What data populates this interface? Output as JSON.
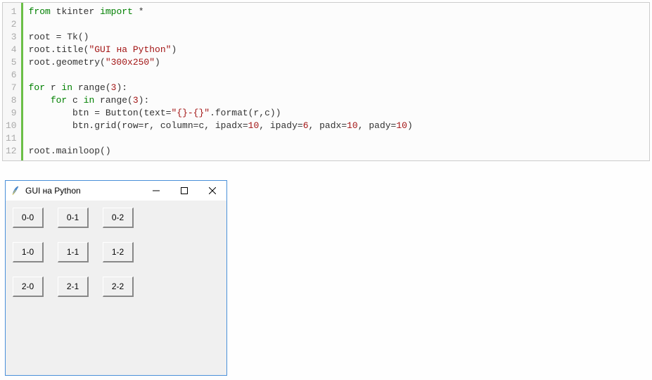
{
  "code": {
    "lines": [
      "1",
      "2",
      "3",
      "4",
      "5",
      "6",
      "7",
      "8",
      "9",
      "10",
      "11",
      "12"
    ]
  },
  "tokens": {
    "l1_from": "from",
    "l1_mod": "tkinter",
    "l1_import": "import",
    "l1_star": "*",
    "l3_root": "root = Tk()",
    "l4_a": "root.title(",
    "l4_s": "\"GUI на Python\"",
    "l4_b": ")",
    "l5_a": "root.geometry(",
    "l5_s": "\"300x250\"",
    "l5_b": ")",
    "l7_for": "for",
    "l7_r": " r ",
    "l7_in": "in",
    "l7_range": " range(",
    "l7_n": "3",
    "l7_end": "):",
    "l8_for": "for",
    "l8_c": " c ",
    "l8_in": "in",
    "l8_range": " range(",
    "l8_n": "3",
    "l8_end": "):",
    "l9_a": "btn = Button(text=",
    "l9_s": "\"{}-{}\"",
    "l9_b": ".format(r,c))",
    "l10": "btn.grid(row=r, column=c, ipadx=",
    "l10_n1": "10",
    "l10_c1": ", ipady=",
    "l10_n2": "6",
    "l10_c2": ", padx=",
    "l10_n3": "10",
    "l10_c3": ", pady=",
    "l10_n4": "10",
    "l10_end": ")",
    "l12": "root.mainloop()"
  },
  "window": {
    "title": "GUI на Python",
    "buttons": {
      "r0c0": "0-0",
      "r0c1": "0-1",
      "r0c2": "0-2",
      "r1c0": "1-0",
      "r1c1": "1-1",
      "r1c2": "1-2",
      "r2c0": "2-0",
      "r2c1": "2-1",
      "r2c2": "2-2"
    }
  }
}
